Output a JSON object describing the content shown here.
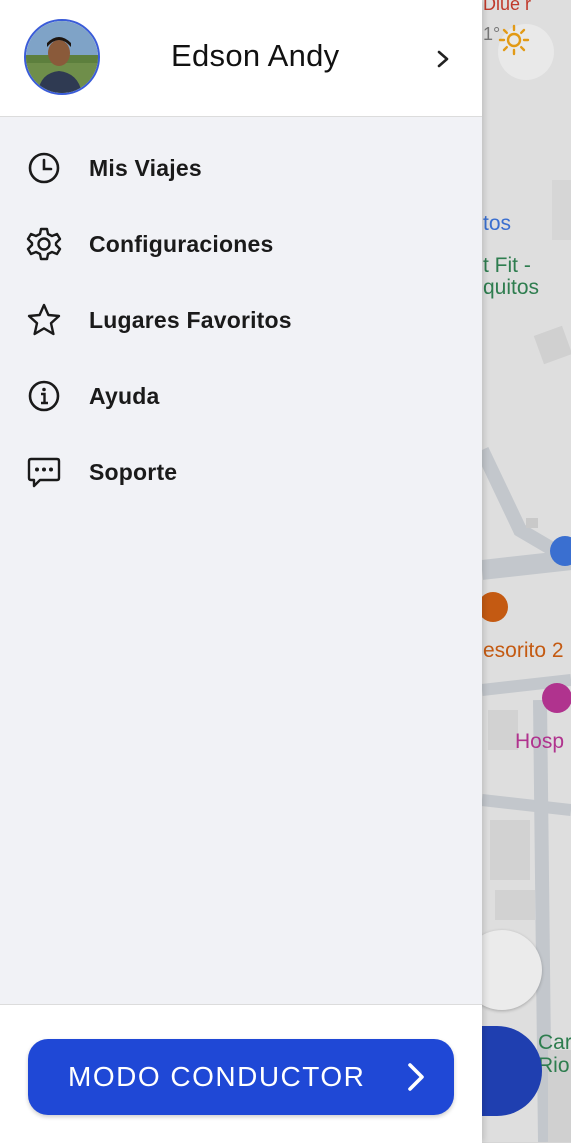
{
  "map": {
    "labels": {
      "tos": "tos",
      "fit": "t Fit -",
      "quitos": "quitos",
      "tesorito": "esorito 2",
      "hosp": "Hosp",
      "car": "Car",
      "rio": "Rio",
      "temp": "1°",
      "top_text": "Diue r"
    },
    "weather_icon": "sun-icon",
    "locate_icon": "crosshair-icon",
    "colors": {
      "poi_blue": "#3a6fd0",
      "poi_green": "#2e7d4f",
      "poi_orange": "#c45a12",
      "poi_pink": "#b0338e"
    }
  },
  "drawer": {
    "user": {
      "name": "Edson Andy",
      "avatar_icon": "user-photo"
    },
    "menu": [
      {
        "label": "Mis Viajes",
        "icon": "clock-icon"
      },
      {
        "label": "Configuraciones",
        "icon": "gear-icon"
      },
      {
        "label": "Lugares Favoritos",
        "icon": "star-icon"
      },
      {
        "label": "Ayuda",
        "icon": "info-icon"
      },
      {
        "label": "Soporte",
        "icon": "chat-icon"
      }
    ],
    "driver_mode": {
      "label": "MODO CONDUCTOR",
      "color": "#1f48d6"
    }
  }
}
